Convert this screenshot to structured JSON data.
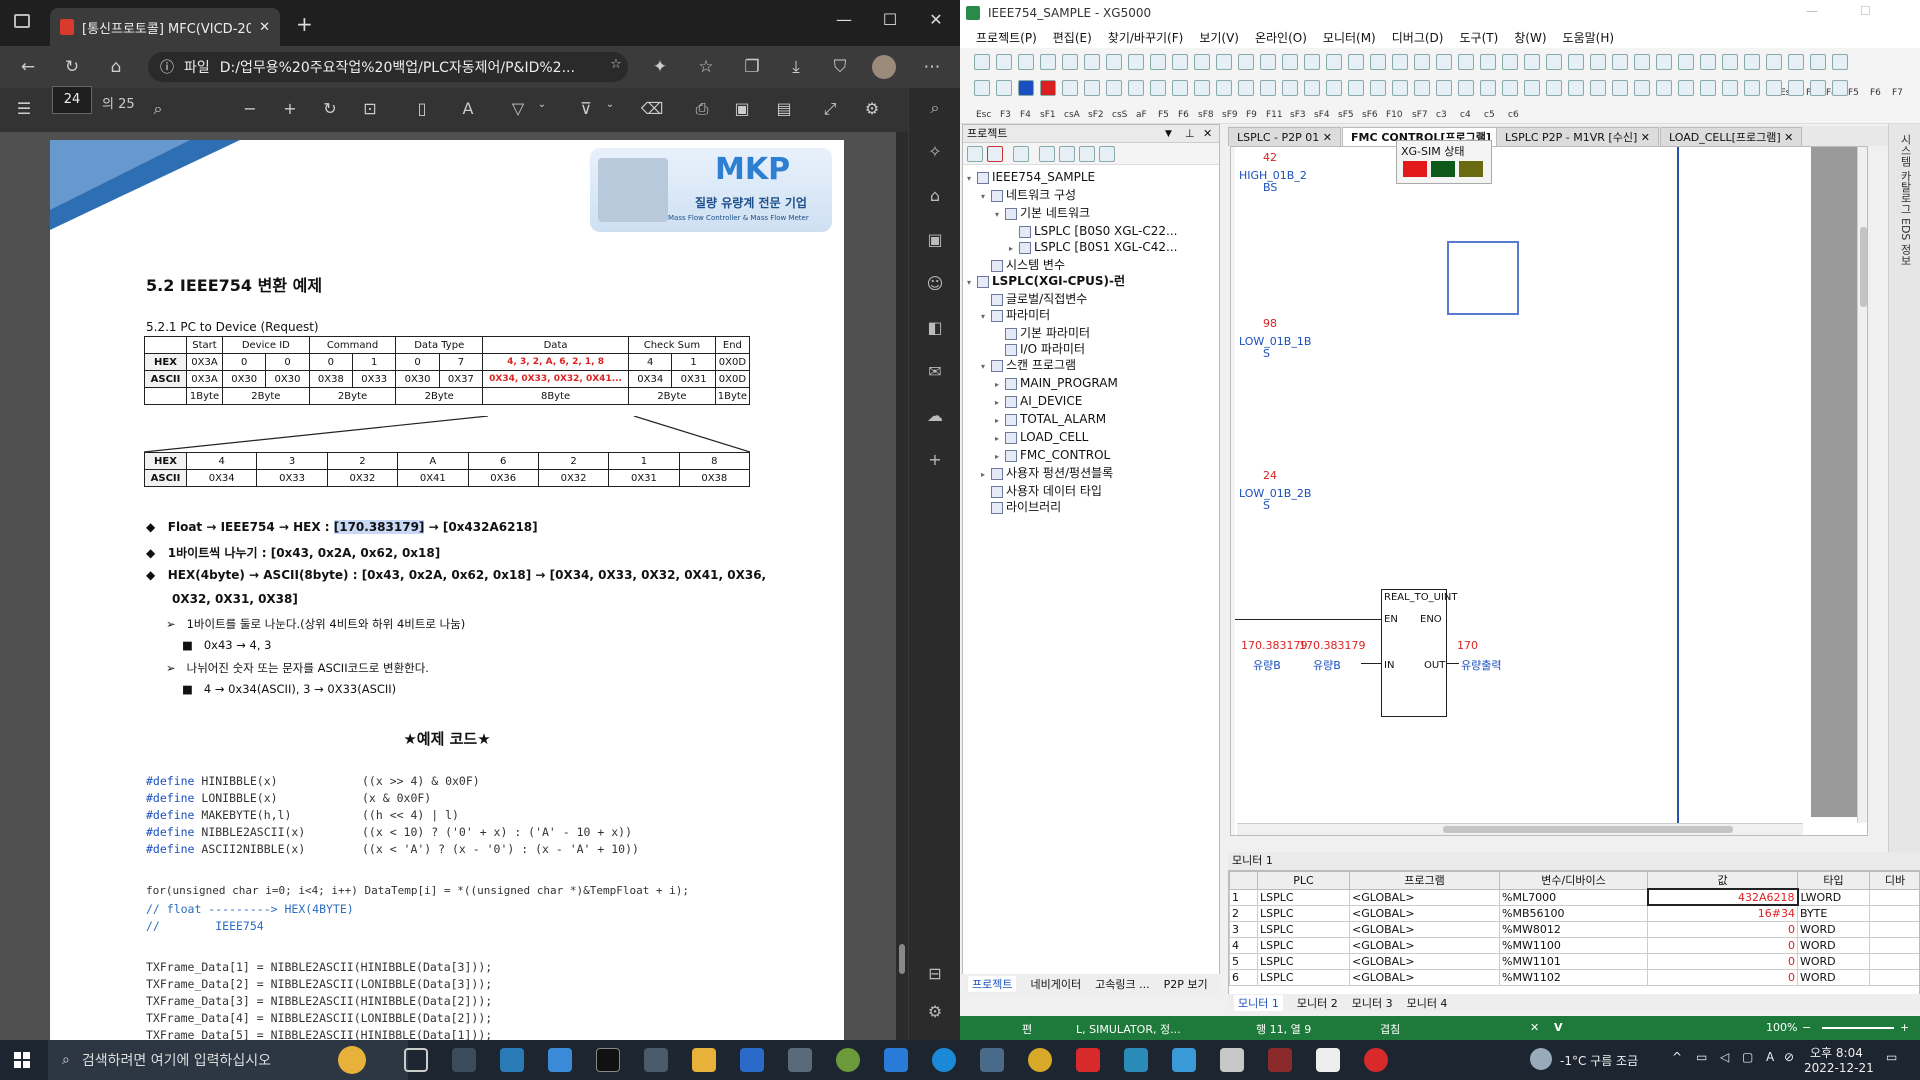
{
  "edge": {
    "tab_title": "[통신프로토콜] MFC(VICD-200S",
    "url_label": "파일",
    "url": "D:/업무용%20주요작업%20백업/PLC자동제어/P&ID%2...",
    "page_number": "24",
    "page_count": "의 25"
  },
  "doc": {
    "logo_text": "MKP",
    "logo_sub1": "질량 유량계 전문 기업",
    "logo_sub2": "Mass Flow Controller & Mass Flow Meter",
    "section_title": "5.2 IEEE754 변환 예제",
    "subsection": "5.2.1 PC to Device (Request)",
    "table1": {
      "header": [
        "",
        "Start",
        "Device ID",
        "Command",
        "Data Type",
        "Data",
        "Check Sum",
        "End"
      ],
      "hex": [
        "HEX",
        "0X3A",
        "0",
        "0",
        "0",
        "1",
        "0",
        "7",
        "4, 3, 2, A, 6, 2, 1, 8",
        "4",
        "1",
        "0X0D"
      ],
      "ascii": [
        "ASCII",
        "0X3A",
        "0X30",
        "0X30",
        "0X38",
        "0X33",
        "0X30",
        "0X37",
        "0X34, 0X33, 0X32, 0X41...",
        "0X34",
        "0X31",
        "0X0D"
      ],
      "size": [
        "",
        "1Byte",
        "2Byte",
        "2Byte",
        "2Byte",
        "8Byte",
        "2Byte",
        "1Byte"
      ]
    },
    "table2": {
      "hex": [
        "HEX",
        "4",
        "3",
        "2",
        "A",
        "6",
        "2",
        "1",
        "8"
      ],
      "ascii": [
        "ASCII",
        "0X34",
        "0X33",
        "0X32",
        "0X41",
        "0X36",
        "0X32",
        "0X31",
        "0X38"
      ]
    },
    "bullet1_pre": "Float → IEEE754 → HEX : ",
    "bullet1_hl": "[170.383179]",
    "bullet1_post": " → [0x432A6218]",
    "bullet2": "1바이트씩 나누기 : [0x43, 0x2A, 0x62, 0x18]",
    "bullet3a": "HEX(4byte) → ASCII(8byte) : [0x43, 0x2A, 0x62, 0x18] → [0X34, 0X33, 0X32, 0X41, 0X36,",
    "bullet3b": "0X32, 0X31, 0X38]",
    "sub1": "1바이트를 둘로 나눈다.(상위 4비트와 하위 4비트로 나눔)",
    "sub1a": "0x43 → 4, 3",
    "sub2": "나뉘어진 숫자 또는 문자를 ASCII코드로 변환한다.",
    "sub2a": "4 → 0x34(ASCII), 3 → 0X33(ASCII)",
    "code_title": "★예제 코드★",
    "defines": [
      [
        "#define",
        "HINIBBLE(x)",
        "((x >> 4) & 0x0F)"
      ],
      [
        "#define",
        "LONIBBLE(x)",
        "(x & 0x0F)"
      ],
      [
        "#define",
        "MAKEBYTE(h,l)",
        "((h << 4) | l)"
      ],
      [
        "#define",
        "NIBBLE2ASCII(x)",
        "((x < 10) ? ('0' + x) : ('A' - 10 + x))"
      ],
      [
        "#define",
        "ASCII2NIBBLE(x)",
        "((x < 'A') ? (x - '0') : (x - 'A' + 10))"
      ]
    ],
    "for_line": "for(unsigned char i=0; i<4; i++) DataTemp[i] = *((unsigned char *)&TempFloat + i);",
    "comment1": "// float ---------> HEX(4BYTE)",
    "comment2": "//        IEEE754",
    "tx_lines": [
      "TXFrame_Data[1] = NIBBLE2ASCII(HINIBBLE(Data[3]));",
      "TXFrame_Data[2] = NIBBLE2ASCII(LONIBBLE(Data[3]));",
      "TXFrame_Data[3] = NIBBLE2ASCII(HINIBBLE(Data[2]));",
      "TXFrame_Data[4] = NIBBLE2ASCII(LONIBBLE(Data[2]));",
      "TXFrame_Data[5] = NIBBLE2ASCII(HINIBBLE(Data[1]));"
    ]
  },
  "xg": {
    "title": "IEEE754_SAMPLE - XG5000",
    "menu": [
      "프로젝트(P)",
      "편집(E)",
      "찾기/바꾸기(F)",
      "보기(V)",
      "온라인(O)",
      "모니터(M)",
      "디버그(D)",
      "도구(T)",
      "창(W)",
      "도움말(H)"
    ],
    "fkeys": [
      "Esc",
      "F3",
      "F4",
      "sF1",
      "csA",
      "sF2",
      "csS",
      "aF",
      "F5",
      "F6",
      "sF8",
      "sF9",
      "F9",
      "F11",
      "sF3",
      "sF4",
      "sF5",
      "sF6",
      "F10",
      "sF7",
      "c3",
      "c4",
      "c5",
      "c6"
    ],
    "fkeys_right": [
      "Esc",
      "F3",
      "F4",
      "F5",
      "F6",
      "F7"
    ],
    "project_pane_title": "프로젝트",
    "tree": [
      {
        "label": "IEEE754_SAMPLE",
        "level": 0,
        "arrow": "▾"
      },
      {
        "label": "네트워크 구성",
        "level": 1,
        "arrow": "▾"
      },
      {
        "label": "기본 네트워크",
        "level": 2,
        "arrow": "▾"
      },
      {
        "label": "LSPLC [B0S0 XGL-C22...",
        "level": 3,
        "arrow": ""
      },
      {
        "label": "LSPLC [B0S1 XGL-C42...",
        "level": 3,
        "arrow": "▸"
      },
      {
        "label": "시스템 변수",
        "level": 1,
        "arrow": ""
      },
      {
        "label": "LSPLC(XGI-CPUS)-런",
        "level": 0,
        "arrow": "▾"
      },
      {
        "label": "글로벌/직접변수",
        "level": 1,
        "arrow": ""
      },
      {
        "label": "파라미터",
        "level": 1,
        "arrow": "▾"
      },
      {
        "label": "기본 파라미터",
        "level": 2,
        "arrow": ""
      },
      {
        "label": "I/O 파라미터",
        "level": 2,
        "arrow": ""
      },
      {
        "label": "스캔 프로그램",
        "level": 1,
        "arrow": "▾"
      },
      {
        "label": "MAIN_PROGRAM",
        "level": 2,
        "arrow": "▸"
      },
      {
        "label": "AI_DEVICE",
        "level": 2,
        "arrow": "▸"
      },
      {
        "label": "TOTAL_ALARM",
        "level": 2,
        "arrow": "▸"
      },
      {
        "label": "LOAD_CELL",
        "level": 2,
        "arrow": "▸"
      },
      {
        "label": "FMC_CONTROL",
        "level": 2,
        "arrow": "▸"
      },
      {
        "label": "사용자 펑션/펑션블록",
        "level": 1,
        "arrow": "▸"
      },
      {
        "label": "사용자 데이터 타입",
        "level": 1,
        "arrow": ""
      },
      {
        "label": "라이브러리",
        "level": 1,
        "arrow": ""
      }
    ],
    "proj_tabs": [
      "프로젝트",
      "네비게이터",
      "고속링크 ...",
      "P2P 보기"
    ],
    "ladder_tabs": [
      "LSPLC - P2P 01",
      "FMC CONTROL[프로그램]",
      "LSPLC P2P - M1VR [수신]",
      "LOAD_CELL[프로그램]"
    ],
    "sim_title": "XG-SIM 상태",
    "ladder": {
      "n1": "42",
      "v1a": "HIGH_01B_2",
      "v1b": "BS",
      "n2": "98",
      "v2a": "LOW_01B_1B",
      "v2b": "S",
      "n3": "24",
      "v3a": "LOW_01B_2B",
      "v3b": "S",
      "fb_name": "REAL_TO_UINT",
      "fb_en": "EN",
      "fb_eno": "ENO",
      "fb_in": "IN",
      "fb_out": "OUT",
      "in_val1": "170.383179",
      "in_val2": "170.383179",
      "out_val": "170",
      "in_var1": "유량B",
      "in_var2": "유량B",
      "out_var": "유량출력"
    },
    "right_strip": "시스템 카탈로그 EDS 정보",
    "monitor_title": "모니터 1",
    "monitor_cols": [
      "",
      "PLC",
      "프로그램",
      "변수/디바이스",
      "값",
      "타입",
      "디바"
    ],
    "monitor_rows": [
      [
        "1",
        "LSPLC",
        "<GLOBAL>",
        "%ML7000",
        "432A6218",
        "LWORD"
      ],
      [
        "2",
        "LSPLC",
        "<GLOBAL>",
        "%MB56100",
        "16#34",
        "BYTE"
      ],
      [
        "3",
        "LSPLC",
        "<GLOBAL>",
        "%MW8012",
        "0",
        "WORD"
      ],
      [
        "4",
        "LSPLC",
        "<GLOBAL>",
        "%MW1100",
        "0",
        "WORD"
      ],
      [
        "5",
        "LSPLC",
        "<GLOBAL>",
        "%MW1101",
        "0",
        "WORD"
      ],
      [
        "6",
        "LSPLC",
        "<GLOBAL>",
        "%MW1102",
        "0",
        "WORD"
      ]
    ],
    "monitor_tabs": [
      "모니터 1",
      "모니터 2",
      "모니터 3",
      "모니터 4"
    ],
    "status": {
      "left": "편",
      "mode": "L, SIMULATOR, 정...",
      "pos": "행 11, 열 9",
      "ovr": "겹침",
      "zoom": "100%"
    }
  },
  "taskbar": {
    "search_placeholder": "검색하려면 여기에 입력하십시오",
    "weather": "-1°C 구름 조금",
    "time": "오후 8:04",
    "date": "2022-12-21"
  },
  "colors": {
    "xg_status": "#1e7a3a",
    "red": "#d22222",
    "blue": "#1a4fbf",
    "edge_bg": "#2b2b2b"
  }
}
